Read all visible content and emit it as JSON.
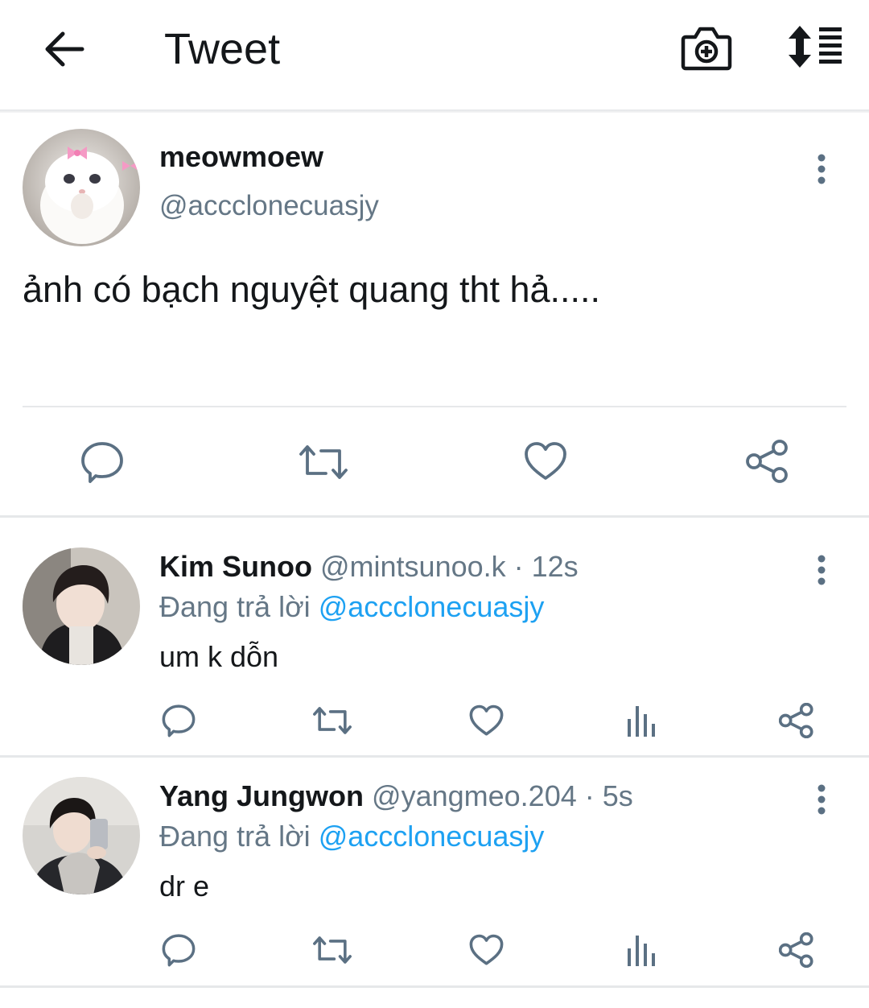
{
  "header": {
    "title": "Tweet",
    "back_icon": "arrow-left-icon",
    "camera_icon": "camera-plus-icon",
    "sort_icon": "sort-list-icon"
  },
  "main_tweet": {
    "display_name": "meowmoew",
    "handle": "@accclonecuasjy",
    "text": "ảnh có bạch nguyệt quang tht hả.....",
    "avatar": "white-kitten-with-pink-bows",
    "actions": [
      "reply-icon",
      "retweet-icon",
      "like-icon",
      "share-icon"
    ]
  },
  "replies": [
    {
      "display_name": "Kim Sunoo",
      "handle_time": "@mintsunoo.k · 12s",
      "replying_prefix": "Đang trả lời",
      "replying_to": "@accclonecuasjy",
      "text": "um k dỗn",
      "avatar": "person-photo"
    },
    {
      "display_name": "Yang Jungwon",
      "handle_time": "@yangmeo.204 · 5s",
      "replying_prefix": "Đang trả lời",
      "replying_to": "@accclonecuasjy",
      "text": "dr e",
      "avatar": "person-selfie-photo"
    }
  ],
  "colors": {
    "text": "#14171a",
    "secondary": "#657786",
    "accent": "#1da1f2",
    "icon": "#5b7083",
    "divider": "#e6e8ea"
  }
}
